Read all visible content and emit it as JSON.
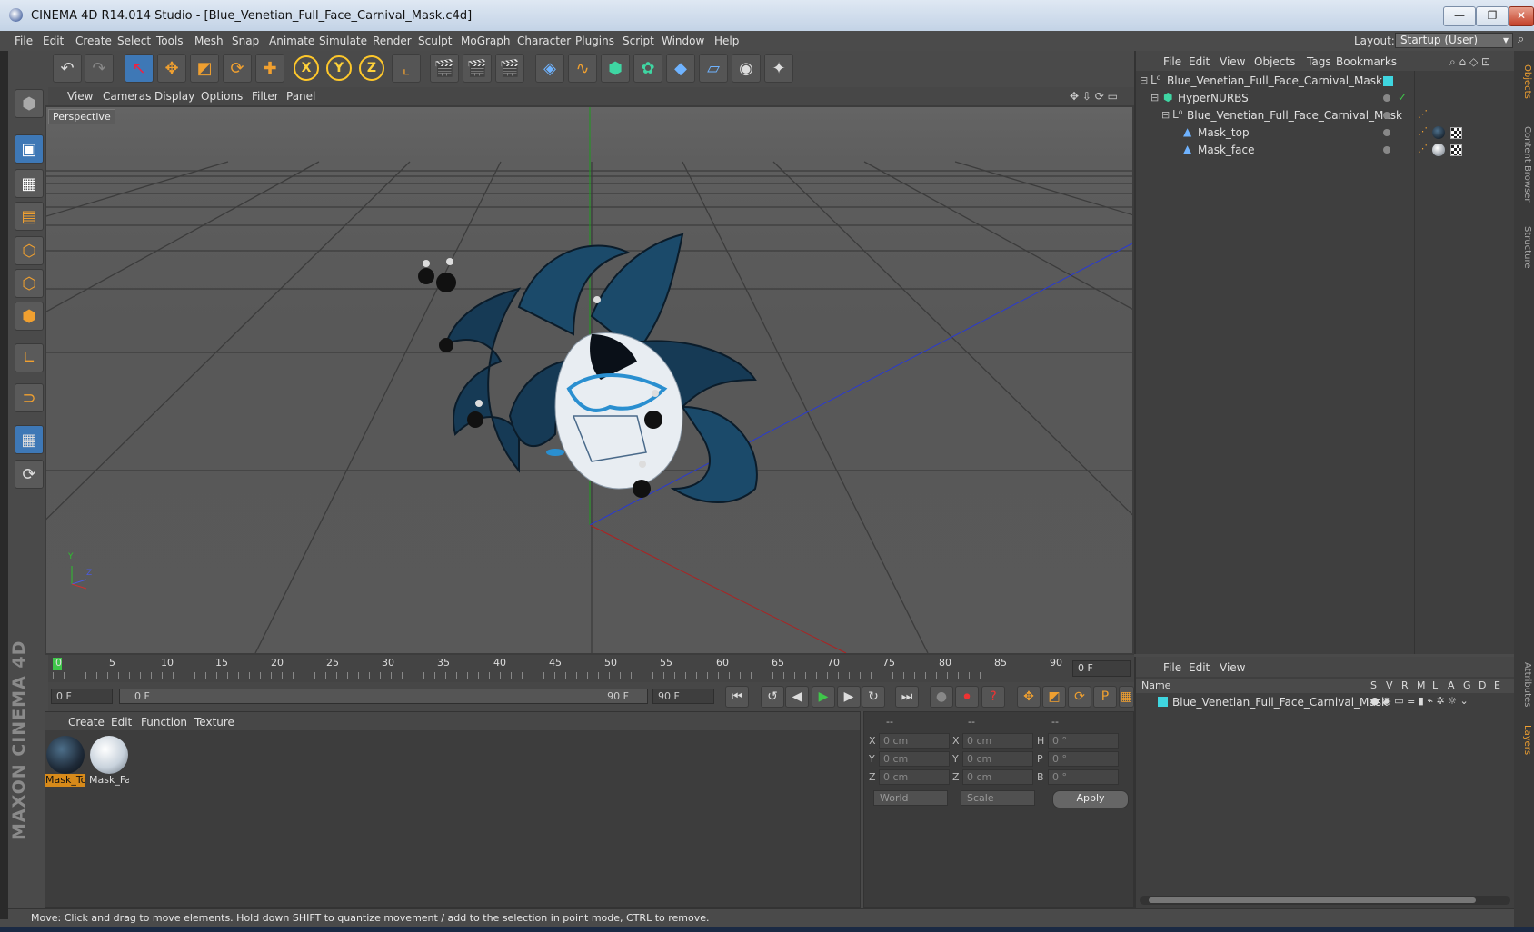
{
  "window": {
    "title": "CINEMA 4D R14.014 Studio - [Blue_Venetian_Full_Face_Carnival_Mask.c4d]",
    "minimize": "—",
    "restore": "❐",
    "close": "✕"
  },
  "menu": [
    "File",
    "Edit",
    "Create",
    "Select",
    "Tools",
    "Mesh",
    "Snap",
    "Animate",
    "Simulate",
    "Render",
    "Sculpt",
    "MoGraph",
    "Character",
    "Plugins",
    "Script",
    "Window",
    "Help"
  ],
  "layout": {
    "label": "Layout:",
    "value": "Startup (User)"
  },
  "toolbar": {
    "axis_x": "X",
    "axis_y": "Y",
    "axis_z": "Z"
  },
  "viewport": {
    "menu": [
      "View",
      "Cameras",
      "Display",
      "Options",
      "Filter",
      "Panel"
    ],
    "label": "Perspective",
    "axis_y": "Y",
    "axis_z": "Z"
  },
  "timeline": {
    "ticks": [
      "0",
      "5",
      "10",
      "15",
      "20",
      "25",
      "30",
      "35",
      "40",
      "45",
      "50",
      "55",
      "60",
      "65",
      "70",
      "75",
      "80",
      "85",
      "90"
    ],
    "current_frame": "0 F"
  },
  "transport": {
    "start": "0 F",
    "range_start": "0 F",
    "range_end": "90 F",
    "end": "90 F"
  },
  "materials": {
    "menu": [
      "Create",
      "Edit",
      "Function",
      "Texture"
    ],
    "items": [
      {
        "name": "Mask_To",
        "color": "#1e2a38",
        "selected": true
      },
      {
        "name": "Mask_Fa",
        "color": "#c8d2dc",
        "selected": false
      }
    ]
  },
  "coords": {
    "header": [
      "--",
      "--",
      "--"
    ],
    "rows": [
      {
        "a": "X",
        "av": "0 cm",
        "b": "X",
        "bv": "0 cm",
        "c": "H",
        "cv": "0 °"
      },
      {
        "a": "Y",
        "av": "0 cm",
        "b": "Y",
        "bv": "0 cm",
        "c": "P",
        "cv": "0 °"
      },
      {
        "a": "Z",
        "av": "0 cm",
        "b": "Z",
        "bv": "0 cm",
        "c": "B",
        "cv": "0 °"
      }
    ],
    "mode1": "World",
    "mode2": "Scale",
    "apply": "Apply"
  },
  "objects": {
    "menu": [
      "File",
      "Edit",
      "View",
      "Objects",
      "Tags",
      "Bookmarks"
    ],
    "tree": [
      {
        "name": "Blue_Venetian_Full_Face_Carnival_Mask",
        "level": 0,
        "icon": "null"
      },
      {
        "name": "HyperNURBS",
        "level": 1,
        "icon": "hypernurbs"
      },
      {
        "name": "Blue_Venetian_Full_Face_Carnival_Mask",
        "level": 2,
        "icon": "null"
      },
      {
        "name": "Mask_top",
        "level": 3,
        "icon": "poly"
      },
      {
        "name": "Mask_face",
        "level": 3,
        "icon": "poly"
      }
    ]
  },
  "sidetabs": [
    "Objects",
    "Content Browser",
    "Structure",
    "Attributes",
    "Layers"
  ],
  "layers": {
    "menu": [
      "File",
      "Edit",
      "View"
    ],
    "columns": [
      "Name",
      "S",
      "V",
      "R",
      "M",
      "L",
      "A",
      "G",
      "D",
      "E"
    ],
    "row": {
      "name": "Blue_Venetian_Full_Face_Carnival_Mask",
      "color": "#3fd6e0"
    }
  },
  "status": "Move: Click and drag to move elements. Hold down SHIFT to quantize movement / add to the selection in point mode, CTRL to remove.",
  "maxon": "MAXON CINEMA 4D",
  "colors": {
    "accent": "#f0a030",
    "active_tool": "#3e78b6",
    "mask_blue": "#1b4a6a"
  }
}
